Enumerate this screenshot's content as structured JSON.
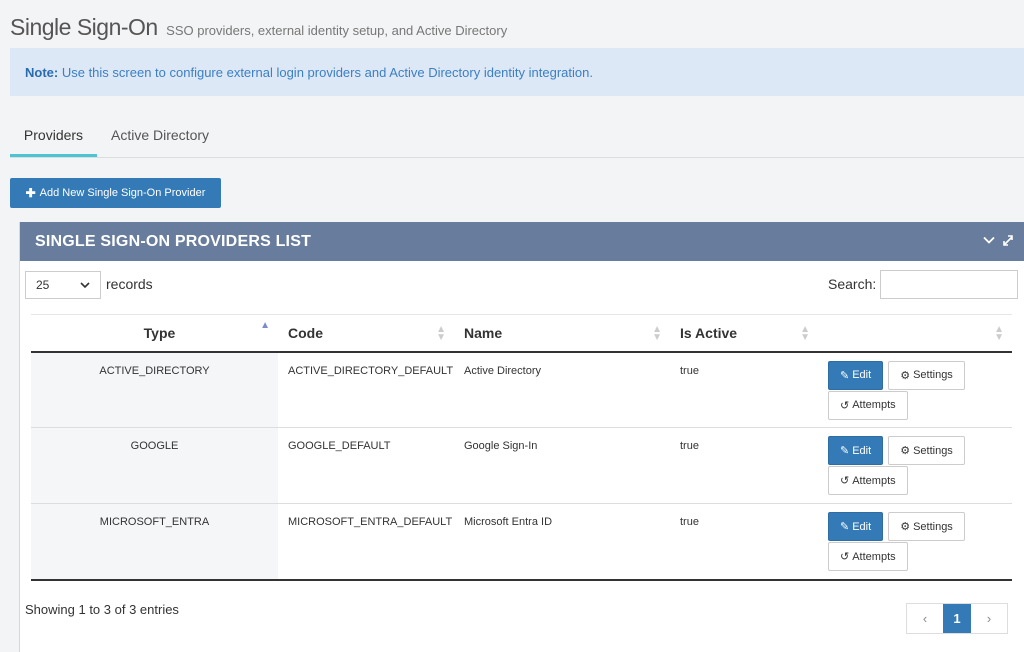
{
  "header": {
    "title": "Single Sign-On",
    "subtitle": "SSO providers, external identity setup, and Active Directory"
  },
  "note": {
    "label": "Note:",
    "text": "Use this screen to configure external login providers and Active Directory identity integration."
  },
  "tabs": [
    {
      "label": "Providers",
      "active": true
    },
    {
      "label": "Active Directory",
      "active": false
    }
  ],
  "add_button": {
    "icon": "plus-icon",
    "label": "Add New Single Sign-On Provider"
  },
  "panel": {
    "title": "SINGLE SIGN-ON PROVIDERS LIST",
    "page_length": "25",
    "records_label": "records",
    "search_label": "Search:",
    "search_value": "",
    "columns": [
      "Type",
      "Code",
      "Name",
      "Is Active",
      ""
    ],
    "rows": [
      {
        "type": "ACTIVE_DIRECTORY",
        "code": "ACTIVE_DIRECTORY_DEFAULT",
        "name": "Active Directory",
        "is_active": "true"
      },
      {
        "type": "GOOGLE",
        "code": "GOOGLE_DEFAULT",
        "name": "Google Sign-In",
        "is_active": "true"
      },
      {
        "type": "MICROSOFT_ENTRA",
        "code": "MICROSOFT_ENTRA_DEFAULT",
        "name": "Microsoft Entra ID",
        "is_active": "true"
      }
    ],
    "row_actions": {
      "edit": "Edit",
      "settings": "Settings",
      "attempts": "Attempts"
    },
    "info": "Showing 1 to 3 of 3 entries",
    "pagination": {
      "prev": "‹",
      "current": "1",
      "next": "›"
    }
  },
  "colors": {
    "primary": "#337ab7",
    "panel_header": "#687d9d",
    "note_bg": "#dde8f6",
    "tab_accent": "#4bc5d4"
  }
}
